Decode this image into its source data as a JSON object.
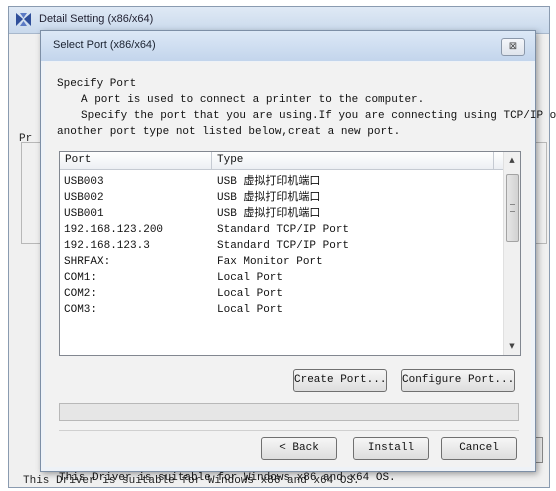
{
  "parent_window": {
    "title": "Detail Setting (x86/x64)",
    "edge_label": "Pr",
    "footer_text": "This Driver is suitable for Windows x86 and x64 OS."
  },
  "dialog": {
    "title": "Select Port (x86/x64)",
    "close_glyph": "⊠",
    "section_title": "Specify Port",
    "intro_line1": "A port is used to connect a printer to the computer.",
    "intro_line2": "Specify the port that you are using.If you are connecting using TCP/IP or",
    "intro_line3": "another port type not listed below,creat a new port.",
    "columns": [
      "Port",
      "Type"
    ],
    "ports": [
      {
        "port": "USB003",
        "type": "USB 虚拟打印机端口"
      },
      {
        "port": "USB002",
        "type": "USB 虚拟打印机端口"
      },
      {
        "port": "USB001",
        "type": "USB 虚拟打印机端口"
      },
      {
        "port": "192.168.123.200",
        "type": "Standard TCP/IP Port"
      },
      {
        "port": "192.168.123.3",
        "type": "Standard TCP/IP Port"
      },
      {
        "port": "SHRFAX:",
        "type": "Fax Monitor Port"
      },
      {
        "port": "COM1:",
        "type": "Local Port"
      },
      {
        "port": "COM2:",
        "type": "Local Port"
      },
      {
        "port": "COM3:",
        "type": "Local Port"
      }
    ],
    "create_port_label": "Create Port...",
    "configure_port_label": "Configure Port...",
    "back_label": "< Back",
    "install_label": "Install",
    "cancel_label": "Cancel",
    "footer_text": "This Driver is suitable for Windows x86 and x64 OS."
  },
  "colors": {
    "titlebar": "#c9d9ec",
    "dialog_bg": "#f2f2f2",
    "list_bg": "#ffffff"
  },
  "icons": {
    "app_icon": "app-icon",
    "close_icon": "close-icon",
    "scroll_up": "scroll-up-arrow-icon",
    "scroll_down": "scroll-down-arrow-icon"
  }
}
